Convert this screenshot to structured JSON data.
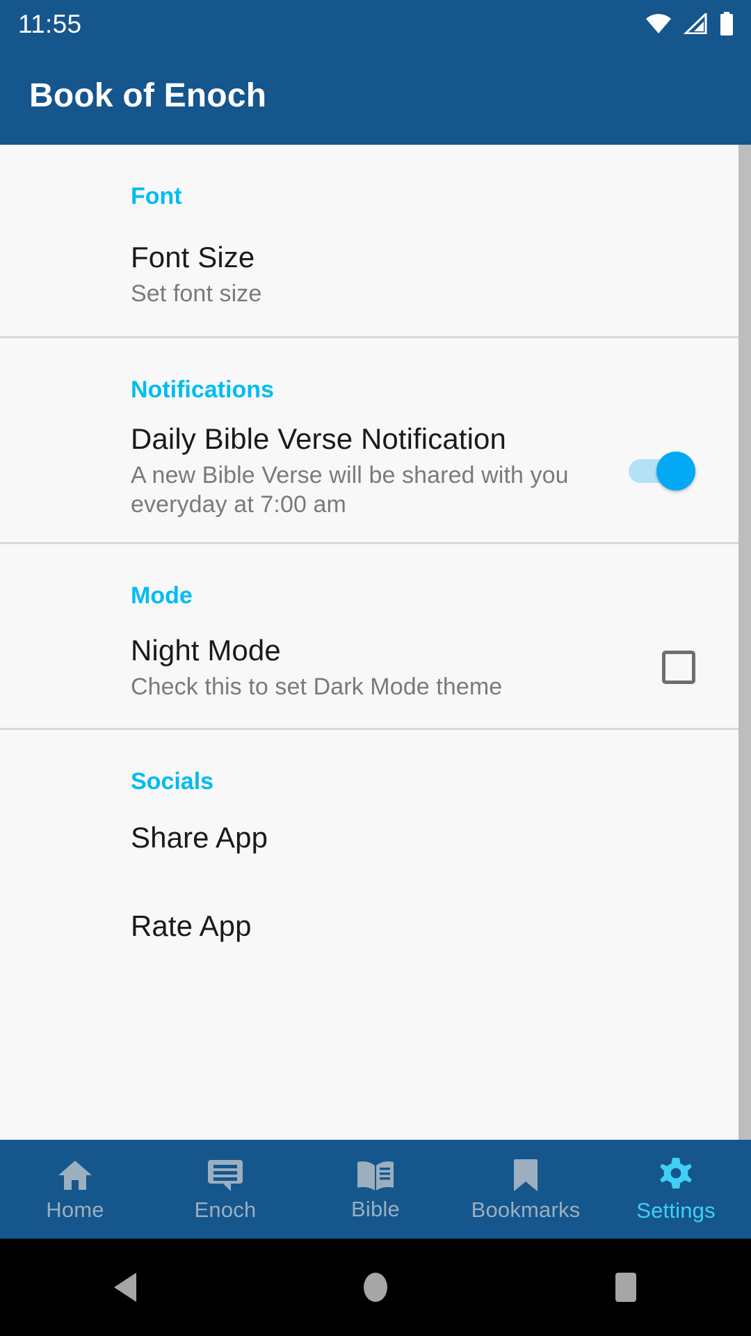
{
  "status_bar": {
    "clock": "11:55",
    "icons": [
      "wifi-icon",
      "cellular-signal-icon",
      "battery-icon"
    ]
  },
  "app_bar": {
    "title": "Book of Enoch"
  },
  "colors": {
    "primary": "#15568C",
    "accent": "#00BCF0",
    "switch_thumb": "#03A9F4",
    "switch_track": "#B3E2F7",
    "background": "#F8F8F8",
    "title_text": "#1A1A1A",
    "summary_text": "#7A7A7A",
    "nav_inactive": "#9BAFBF",
    "nav_active": "#3FD0F5",
    "checkbox_border": "#6E6E6E",
    "divider": "#D8D8D8",
    "scrollbar": "#BDBDBD"
  },
  "sections": [
    {
      "header": "Font",
      "rows": [
        {
          "title": "Font Size",
          "summary": "Set font size",
          "control": "none"
        }
      ]
    },
    {
      "header": "Notifications",
      "rows": [
        {
          "title": "Daily Bible Verse Notification",
          "summary": "A new Bible Verse will be shared with you everyday at 7:00 am",
          "control": "switch",
          "control_state": "on"
        }
      ]
    },
    {
      "header": "Mode",
      "rows": [
        {
          "title": "Night Mode",
          "summary": "Check this to set Dark Mode theme",
          "control": "checkbox",
          "control_state": "off"
        }
      ]
    },
    {
      "header": "Socials",
      "rows": [
        {
          "title": "Share App",
          "summary": "",
          "control": "none"
        },
        {
          "title": "Rate App",
          "summary": "",
          "control": "none"
        }
      ]
    }
  ],
  "bottom_nav": {
    "items": [
      {
        "label": "Home",
        "icon": "home-icon",
        "active": false
      },
      {
        "label": "Enoch",
        "icon": "chat-icon",
        "active": false
      },
      {
        "label": "Bible",
        "icon": "book-icon",
        "active": false
      },
      {
        "label": "Bookmarks",
        "icon": "bookmark-icon",
        "active": false
      },
      {
        "label": "Settings",
        "icon": "gear-icon",
        "active": true
      }
    ]
  },
  "system_nav": {
    "buttons": [
      {
        "name": "back-button",
        "icon": "triangle-back-icon"
      },
      {
        "name": "home-button",
        "icon": "circle-home-icon"
      },
      {
        "name": "recents-button",
        "icon": "square-recents-icon"
      }
    ]
  }
}
